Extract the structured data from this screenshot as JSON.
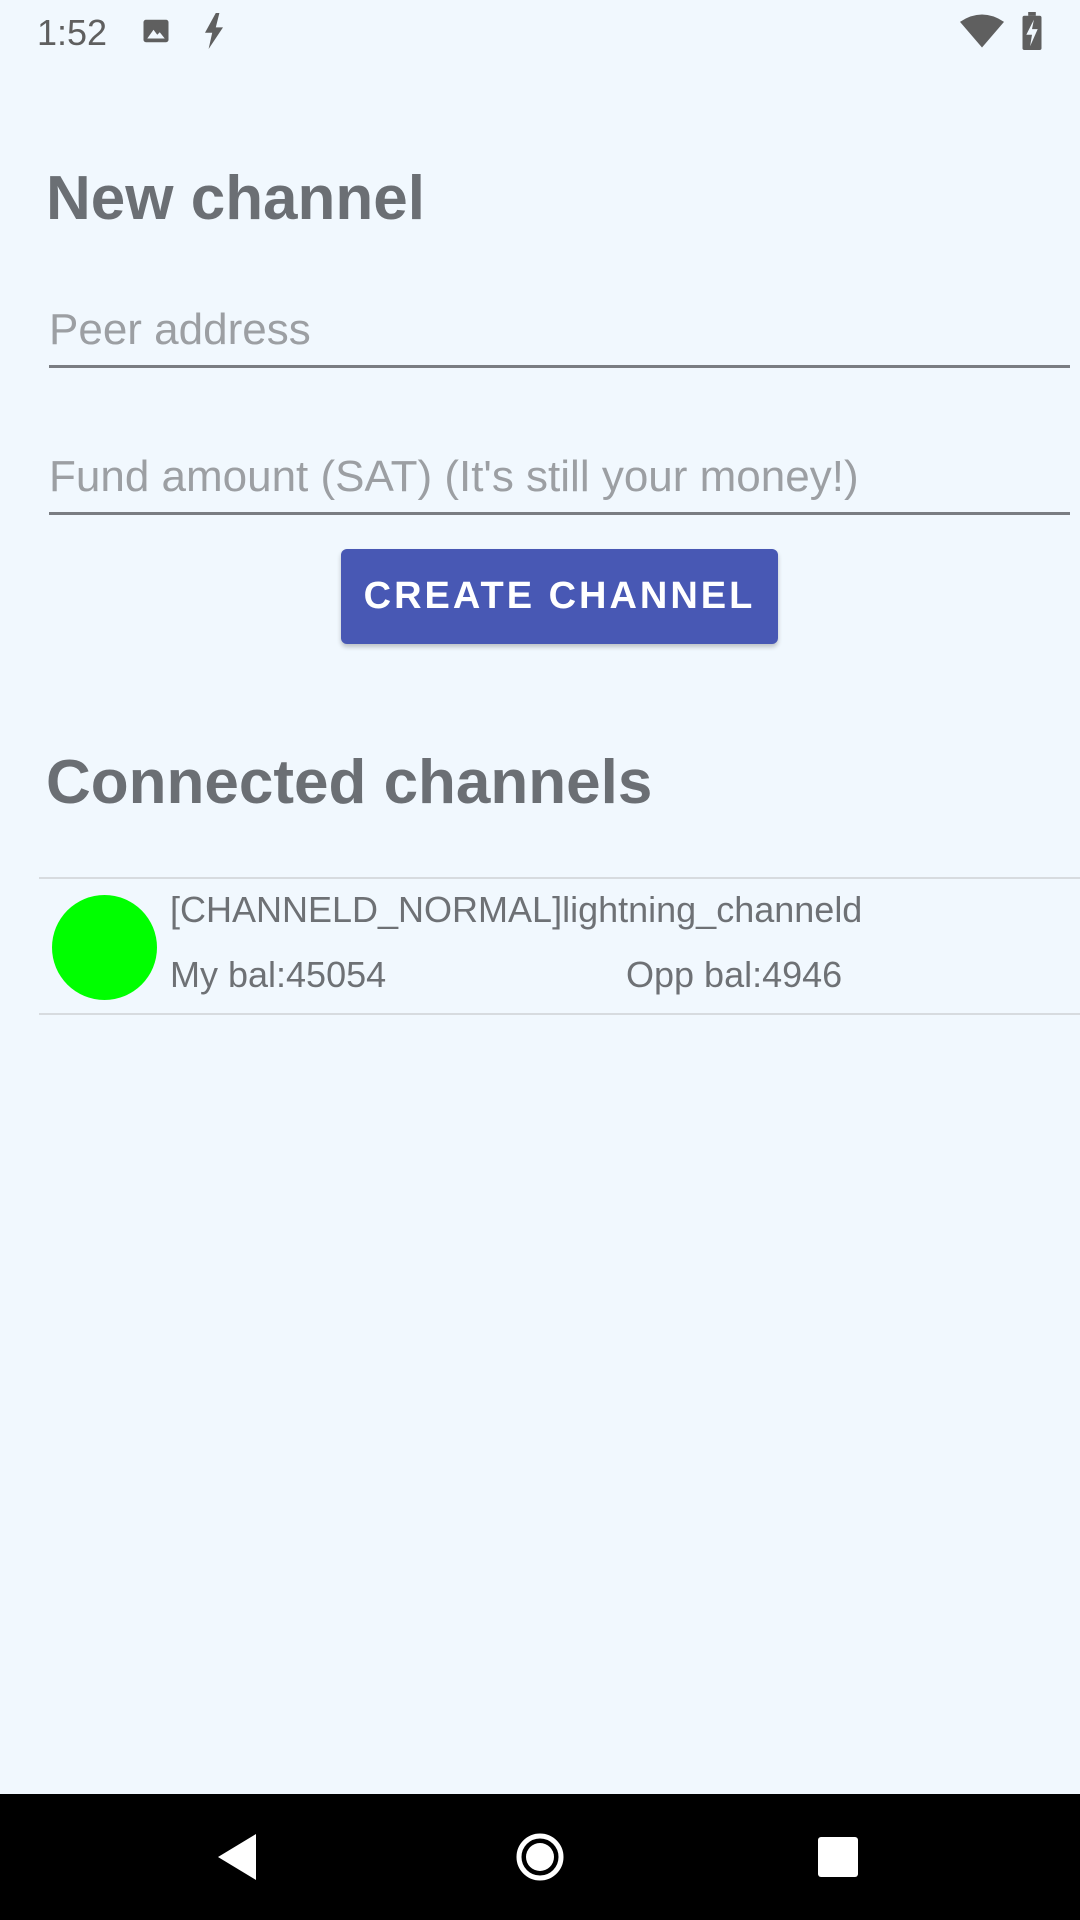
{
  "status_bar": {
    "time": "1:52",
    "icons_left": [
      "image-icon",
      "bolt-icon"
    ],
    "icons_right": [
      "wifi-icon",
      "battery-charging-icon"
    ]
  },
  "new_channel": {
    "heading": "New channel",
    "peer_address": {
      "value": "",
      "placeholder": "Peer address"
    },
    "fund_amount": {
      "value": "",
      "placeholder": "Fund amount (SAT) (It's still your money!)"
    },
    "create_button_label": "CREATE CHANNEL"
  },
  "connected_channels": {
    "heading": "Connected channels",
    "items": [
      {
        "status_color": "#00ff00",
        "name": "[CHANNELD_NORMAL]lightning_channeld",
        "my_balance": "My bal:45054",
        "opp_balance": "Opp bal:4946"
      }
    ]
  },
  "nav_bar": {
    "buttons": [
      "back-icon",
      "home-icon",
      "recents-icon"
    ]
  },
  "colors": {
    "background": "#f1f8fe",
    "accent": "#4858b4",
    "heading": "#6b6f74",
    "status_online": "#00ff00"
  }
}
